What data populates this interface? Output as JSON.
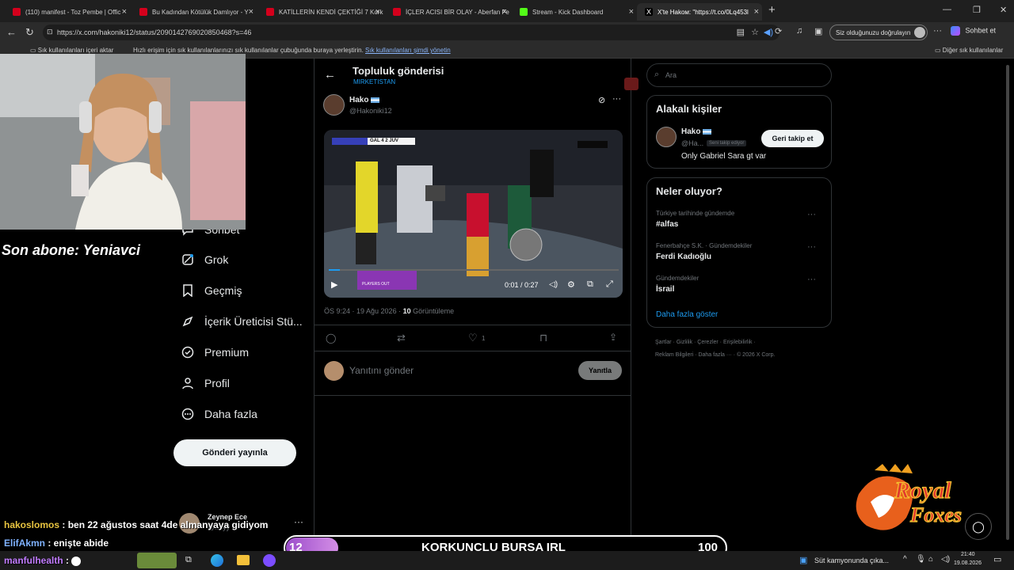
{
  "browser": {
    "tabs": [
      {
        "label": "(110) manifest - Toz Pembe | Offic",
        "icon": "youtube-icon"
      },
      {
        "label": "Bu Kadından Kötülük Damlıyor - Y",
        "icon": "youtube-icon"
      },
      {
        "label": "KATİLLERİN KENDİ ÇEKTİĞİ 7 Korkı",
        "icon": "youtube-icon"
      },
      {
        "label": "İÇLER ACISI BİR OLAY - Aberfan Fe",
        "icon": "youtube-icon"
      },
      {
        "label": "Stream - Kick Dashboard",
        "icon": "kick-icon"
      },
      {
        "label": "X'te Hakoм: \"https://t.co/0Lq453l",
        "icon": "x-icon"
      }
    ],
    "new_tab": "+",
    "url": "https://x.com/hakoniki12/status/2090142769020850468?s=46",
    "signin_label": "Siz olduğunuzu doğrulayın",
    "copilot_label": "Sohbet et",
    "bookmarks": {
      "import": "Sık kullanılanları içeri aktar",
      "hint": "Hızlı erişim için sık kullanılanlarınızı sık kullanılanlar çubuğunda buraya yerleştirin.",
      "manage_link": "Sık kullanılanları şimdi yönetin",
      "other": "Diğer sık kullanılanlar"
    }
  },
  "overlay": {
    "son_abone": "Son abone: Yeniavci",
    "chat": [
      {
        "user": "hakoslomos",
        "color": "#e8c440",
        "msg": " : ben 22 ağustos saat 4de almanyaya gidiyom"
      },
      {
        "user": "ElifAkmn",
        "color": "#7fb2ff",
        "msg": " : enişte abide"
      },
      {
        "user": "manfulhealth",
        "color": "#c17bff",
        "msg": " :"
      }
    ],
    "goal": {
      "current": "12",
      "title": "KORKUNÇLU BURSA IRL",
      "target": "100",
      "progress": 0.12
    },
    "partial_text": "er"
  },
  "sidebar": {
    "items": [
      {
        "label": "Sohbet",
        "icon": "chat-icon"
      },
      {
        "label": "Grok",
        "icon": "grok-icon"
      },
      {
        "label": "Geçmiş",
        "icon": "bookmark-icon"
      },
      {
        "label": "İçerik Üreticisi Stü...",
        "icon": "rocket-icon"
      },
      {
        "label": "Premium",
        "icon": "verified-icon"
      },
      {
        "label": "Profil",
        "icon": "person-icon"
      },
      {
        "label": "Daha fazla",
        "icon": "more-circle-icon"
      }
    ],
    "post_button": "Gönderi yayınla",
    "account_name": "Zeynep Ece",
    "account_handle": "@... yy"
  },
  "post": {
    "header_title": "Topluluk gönderisi",
    "header_sub": "MIRKETISTAN",
    "author_name": "Hako",
    "author_handle": "@Hakoniki12",
    "scoreboard": "GAL 4  2  JUV",
    "video_caption": "PLAYERS OUT",
    "video_time": "0:01 / 0:27",
    "timestamp": "ÖS 9:24 · 19 Ağu 2026 · ",
    "views": "10",
    "views_label": " Görüntüleme",
    "likes": "1",
    "reply_placeholder": "Yanıtını gönder",
    "reply_button": "Yanıtla"
  },
  "right": {
    "search_placeholder": "Ara",
    "related_title": "Alakalı kişiler",
    "related_name": "Hako",
    "related_handle": "@Ha...",
    "follows_you": "Seni takip ediyor",
    "follow_back": "Geri takip et",
    "related_bio": "Only Gabriel Sara gt var",
    "trends_title": "Neler oluyor?",
    "trends": [
      {
        "meta": "Türkiye tarihinde gündemde",
        "title": "#alfas"
      },
      {
        "meta": "Fenerbahçe S.K. · Gündemdekiler",
        "title": "Ferdi Kadıoğlu"
      },
      {
        "meta": "Gündemdekiler",
        "title": "İsrail"
      }
    ],
    "show_more": "Daha fazla göster",
    "footer1": "Şartlar  ·  Gizlilik  ·  Çerezler  ·  Erişilebilirlik  ·",
    "footer2": "Reklam Bilgileri  ·  Daha fazla ···  ·  © 2026 X Corp."
  },
  "taskbar": {
    "news": "Süt kamyonunda çıka...",
    "time": "21:40",
    "date": "19.08.2026"
  },
  "colors": {
    "accent": "#1d9bf0",
    "bg": "#000000",
    "border": "#2f3336"
  }
}
